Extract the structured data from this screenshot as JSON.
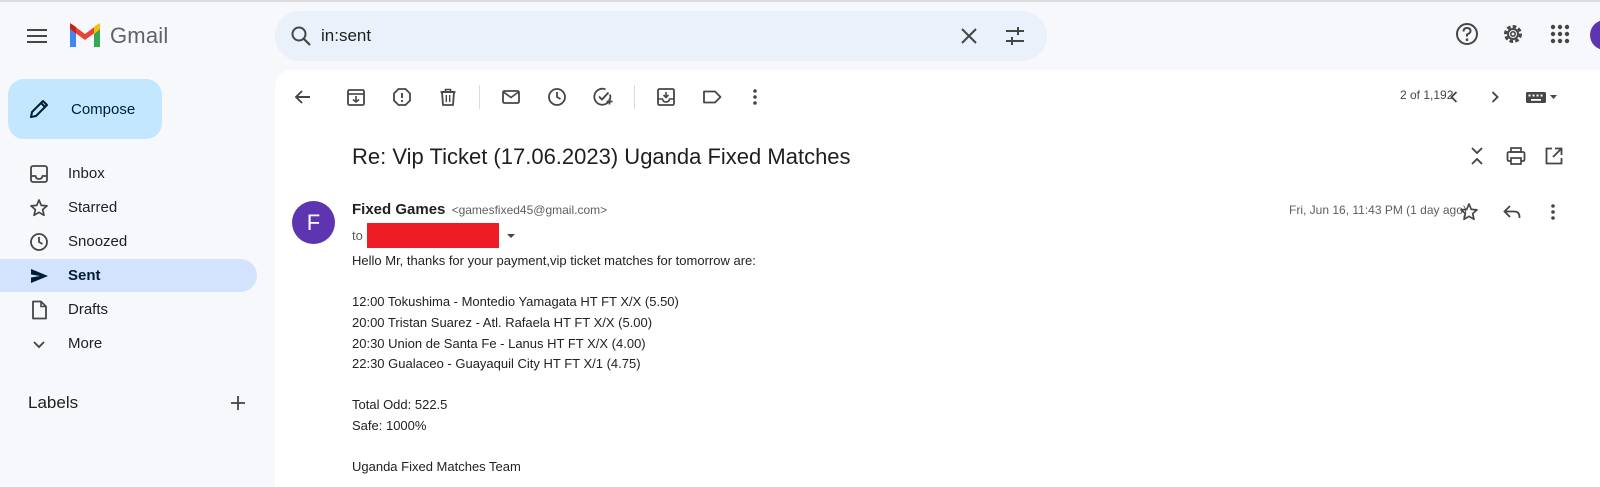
{
  "app": {
    "name": "Gmail"
  },
  "search": {
    "query": "in:sent"
  },
  "compose": {
    "label": "Compose"
  },
  "sidebar": {
    "items": [
      {
        "label": "Inbox",
        "icon": "inbox-icon"
      },
      {
        "label": "Starred",
        "icon": "star-icon"
      },
      {
        "label": "Snoozed",
        "icon": "clock-icon"
      },
      {
        "label": "Sent",
        "icon": "send-icon",
        "active": true
      },
      {
        "label": "Drafts",
        "icon": "draft-icon"
      },
      {
        "label": "More",
        "icon": "chevron-down-icon"
      }
    ],
    "labels_title": "Labels"
  },
  "toolbar": {
    "pager": "2 of 1,192"
  },
  "message": {
    "subject": "Re: Vip Ticket (17.06.2023) Uganda Fixed Matches",
    "sender_initial": "F",
    "sender_name": "Fixed Games",
    "sender_email": "<gamesfixed45@gmail.com>",
    "to_label": "to",
    "date": "Fri, Jun 16, 11:43 PM (1 day ago)",
    "body": [
      "Hello Mr, thanks for your payment,vip ticket matches for tomorrow are:",
      "12:00 Tokushima - Montedio Yamagata HT FT X/X (5.50)",
      "20:00 Tristan Suarez - Atl. Rafaela HT FT X/X (5.00)",
      "20:30 Union de Santa Fe - Lanus HT FT X/X (4.00)",
      "22:30 Gualaceo - Guayaquil City HT FT X/1 (4.75)",
      "Total Odd: 522.5",
      "Safe: 1000%",
      "Uganda Fixed Matches Team"
    ]
  },
  "colors": {
    "accent": "#0b57d0",
    "compose_bg": "#c2e7ff",
    "active_nav": "#d3e3fd",
    "avatar": "#5e35b1",
    "redaction": "#ee1c25"
  }
}
